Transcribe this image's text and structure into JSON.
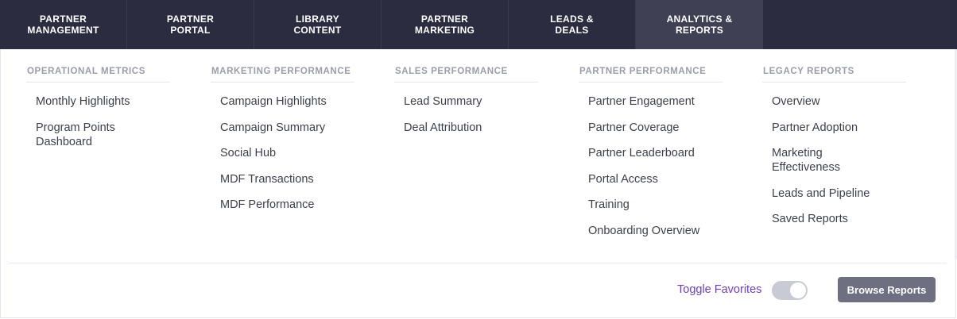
{
  "nav": {
    "tabs": [
      {
        "label": "PARTNER\nMANAGEMENT"
      },
      {
        "label": "PARTNER\nPORTAL"
      },
      {
        "label": "LIBRARY\nCONTENT"
      },
      {
        "label": "PARTNER\nMARKETING"
      },
      {
        "label": "LEADS &\nDEALS"
      },
      {
        "label": "ANALYTICS &\nREPORTS"
      }
    ],
    "active_tab": "ANALYTICS &\nREPORTS"
  },
  "menu": {
    "columns": [
      {
        "heading": "OPERATIONAL METRICS",
        "items": [
          "Monthly Highlights",
          "Program Points Dashboard"
        ]
      },
      {
        "heading": "MARKETING PERFORMANCE",
        "items": [
          "Campaign Highlights",
          "Campaign Summary",
          "Social Hub",
          "MDF Transactions",
          "MDF Performance"
        ]
      },
      {
        "heading": "SALES PERFORMANCE",
        "items": [
          "Lead Summary",
          "Deal Attribution"
        ]
      },
      {
        "heading": "PARTNER PERFORMANCE",
        "items": [
          "Partner Engagement",
          "Partner Coverage",
          "Partner Leaderboard",
          "Portal Access",
          "Training",
          "Onboarding Overview"
        ]
      },
      {
        "heading": "LEGACY REPORTS",
        "items": [
          "Overview",
          "Partner Adoption",
          "Marketing Effectiveness",
          "Leads and Pipeline",
          "Saved Reports"
        ]
      }
    ]
  },
  "footer": {
    "toggle_label": "Toggle Favorites",
    "toggle_on": false,
    "browse_label": "Browse Reports"
  },
  "colors": {
    "nav_bg": "#2b2c3f",
    "nav_active": "#3f4053",
    "accent": "#6d3fd0",
    "button": "#6e7082"
  }
}
